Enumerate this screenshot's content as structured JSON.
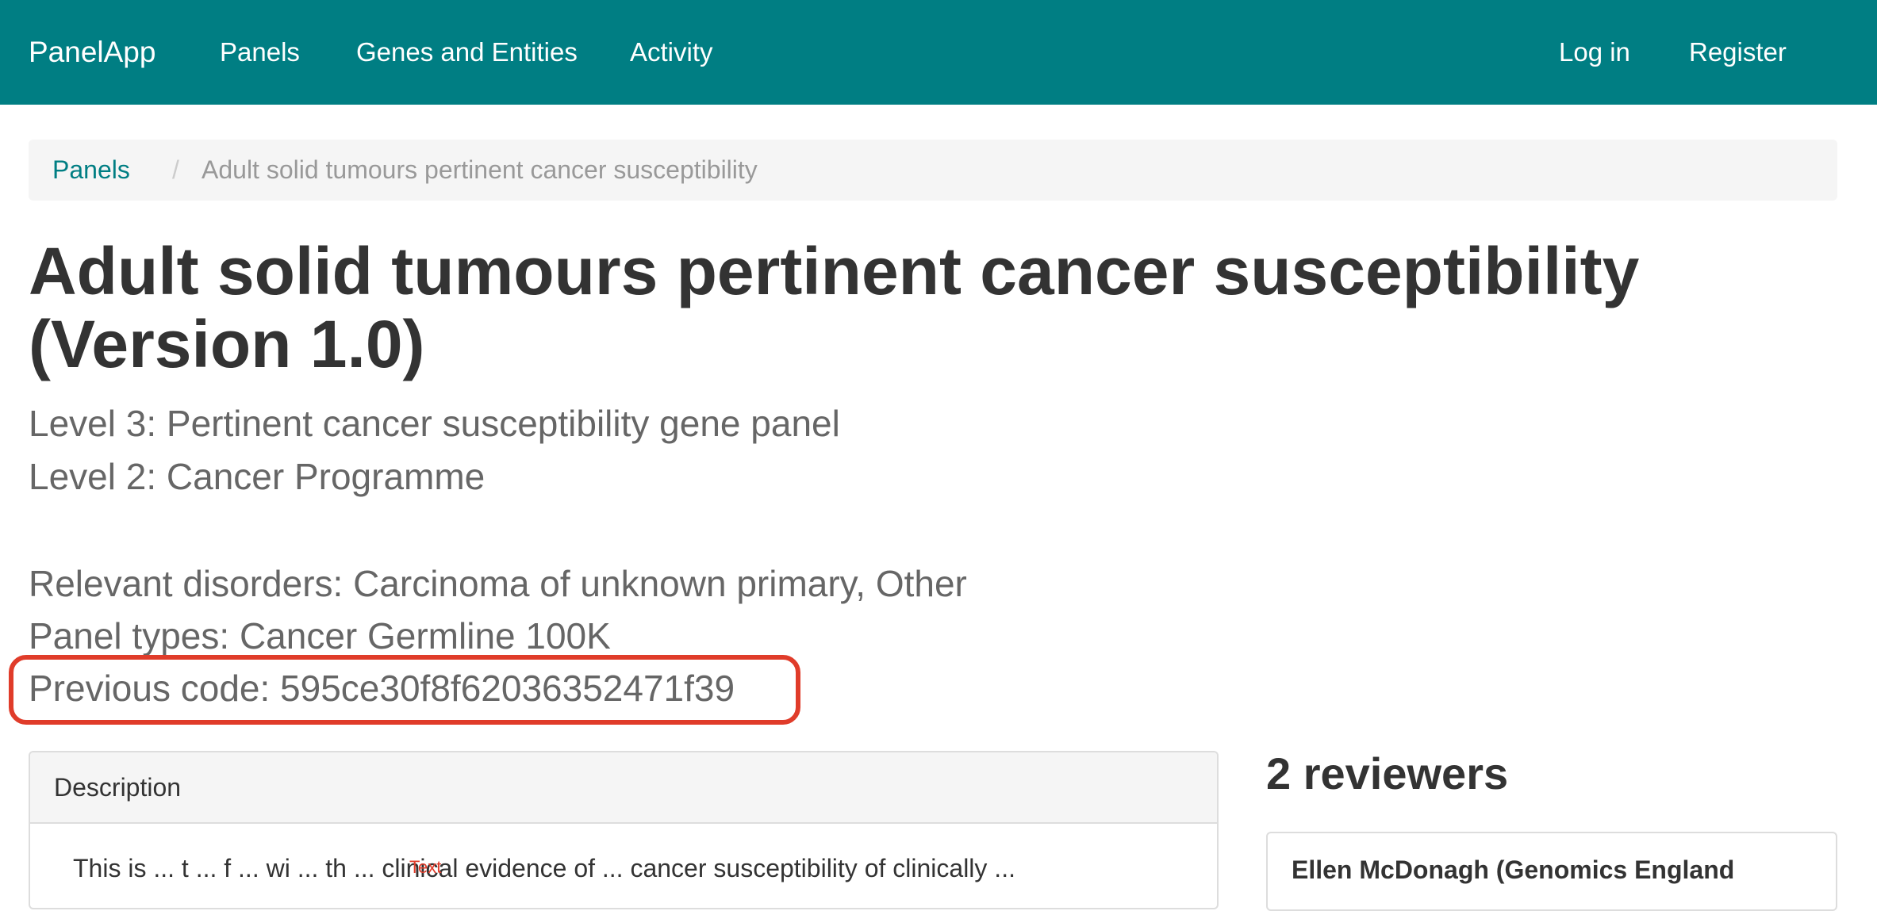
{
  "navbar": {
    "brand": "PanelApp",
    "links": [
      "Panels",
      "Genes and Entities",
      "Activity"
    ],
    "login": "Log in",
    "register": "Register",
    "background_color": "#007e83"
  },
  "breadcrumb": {
    "root": "Panels",
    "separator": "/",
    "current": "Adult solid tumours pertinent cancer susceptibility"
  },
  "panel": {
    "title": "Adult solid tumours pertinent cancer susceptibility (Version 1.0)",
    "level3": "Level 3: Pertinent cancer susceptibility gene panel",
    "level2": "Level 2: Cancer Programme",
    "relevant_disorders": "Relevant disorders: Carcinoma of unknown primary, Other",
    "panel_types": "Panel types: Cancer Germline 100K",
    "previous_code": "Previous code: 595ce30f8f62036352471f39",
    "highlight_color": "#e03c2a"
  },
  "description": {
    "heading": "Description",
    "body_partial": "This is ... t ... f ... wi ... th ... clinical evidence of ... cancer susceptibility of clinically ...",
    "annotation": "Text"
  },
  "reviewers": {
    "heading": "2 reviewers",
    "first_name": "Ellen McDonagh (Genomics England"
  }
}
